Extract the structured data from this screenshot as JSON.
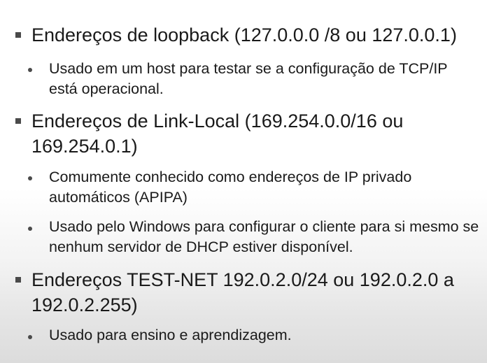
{
  "slide": {
    "items": [
      {
        "text": "Endereços de loopback (127.0.0.0 /8 ou 127.0.0.1)",
        "subitems": [
          "Usado em um host para testar se a configuração de TCP/IP está operacional."
        ]
      },
      {
        "text": "Endereços de Link-Local (169.254.0.0/16 ou 169.254.0.1)",
        "subitems": [
          "Comumente conhecido como endereços de IP privado automáticos (APIPA)",
          "Usado pelo Windows para configurar o cliente para si mesmo se nenhum servidor de DHCP estiver disponível."
        ]
      },
      {
        "text": "Endereços TEST-NET 192.0.2.0/24 ou 192.0.2.0 a 192.0.2.255)",
        "subitems": [
          "Usado para ensino e aprendizagem."
        ]
      }
    ]
  }
}
